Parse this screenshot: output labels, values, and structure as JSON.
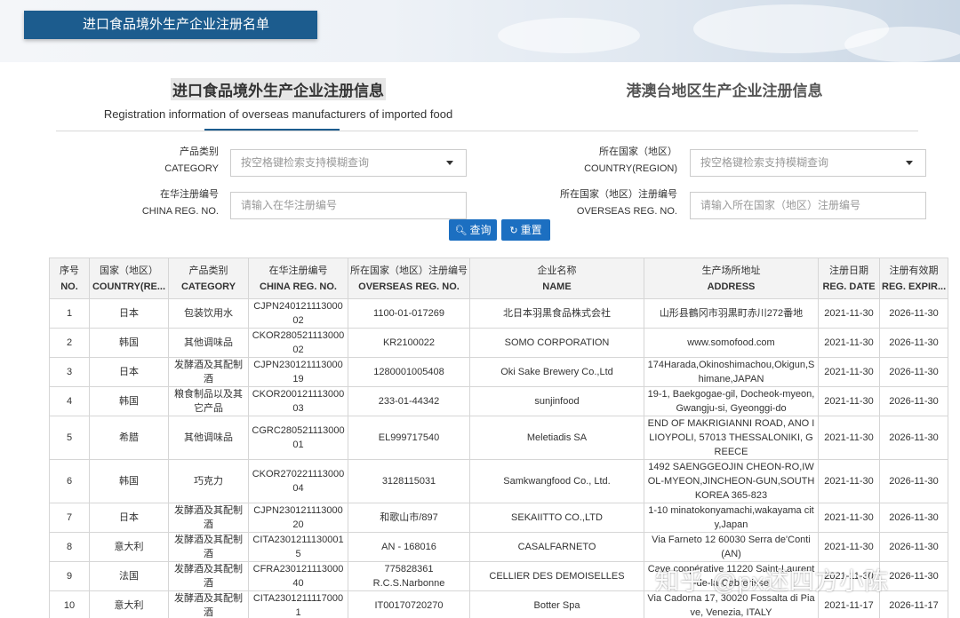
{
  "header": {
    "title": "进口食品境外生产企业注册名单"
  },
  "tabs": [
    {
      "title": "进口食品境外生产企业注册信息",
      "subtitle": "Registration information of overseas manufacturers of imported food"
    },
    {
      "title": "港澳台地区生产企业注册信息",
      "subtitle": ""
    }
  ],
  "form": {
    "category": {
      "label_cn": "产品类别",
      "label_en": "CATEGORY",
      "placeholder": "按空格键检索支持模糊查询"
    },
    "country": {
      "label_cn": "所在国家（地区）",
      "label_en": "COUNTRY(REGION)",
      "placeholder": "按空格键检索支持模糊查询"
    },
    "china_reg": {
      "label_cn": "在华注册编号",
      "label_en": "CHINA REG. NO.",
      "placeholder": "请输入在华注册编号"
    },
    "overseas_reg": {
      "label_cn": "所在国家（地区）注册编号",
      "label_en": "OVERSEAS REG. NO.",
      "placeholder": "请输入所在国家（地区）注册编号"
    },
    "search_label": "查询",
    "reset_label": "重置"
  },
  "table": {
    "columns": [
      {
        "cn": "序号",
        "en": "NO."
      },
      {
        "cn": "国家（地区）",
        "en": "COUNTRY(RE..."
      },
      {
        "cn": "产品类别",
        "en": "CATEGORY"
      },
      {
        "cn": "在华注册编号",
        "en": "CHINA REG. NO."
      },
      {
        "cn": "所在国家（地区）注册编号",
        "en": "OVERSEAS REG. NO."
      },
      {
        "cn": "企业名称",
        "en": "NAME"
      },
      {
        "cn": "生产场所地址",
        "en": "ADDRESS"
      },
      {
        "cn": "注册日期",
        "en": "REG. DATE"
      },
      {
        "cn": "注册有效期",
        "en": "REG. EXPIR..."
      }
    ],
    "rows": [
      [
        "1",
        "日本",
        "包装饮用水",
        "CJPN24012111300002",
        "1100-01-017269",
        "北日本羽黒食品株式会社",
        "山形县鶴冈市羽黒町赤川272番地",
        "2021-11-30",
        "2026-11-30"
      ],
      [
        "2",
        "韩国",
        "其他调味品",
        "CKOR28052111300002",
        "KR2100022",
        "SOMO CORPORATION",
        "www.somofood.com",
        "2021-11-30",
        "2026-11-30"
      ],
      [
        "3",
        "日本",
        "发酵酒及其配制酒",
        "CJPN23012111300019",
        "1280001005408",
        "Oki Sake Brewery Co.,Ltd",
        "174Harada,Okinoshimachou,Okigun,Shimane,JAPAN",
        "2021-11-30",
        "2026-11-30"
      ],
      [
        "4",
        "韩国",
        "粮食制品以及其它产品",
        "CKOR20012111300003",
        "233-01-44342",
        "sunjinfood",
        "19-1, Baekgogae-gil, Docheok-myeon, Gwangju-si, Gyeonggi-do",
        "2021-11-30",
        "2026-11-30"
      ],
      [
        "5",
        "希腊",
        "其他调味品",
        "CGRC28052111300001",
        "EL999717540",
        "Meletiadis SA",
        "END OF MAKRIGIANNI ROAD, ANO ILIOYPOLI, 57013 THESSALONIKI, GREECE",
        "2021-11-30",
        "2026-11-30"
      ],
      [
        "6",
        "韩国",
        "巧克力",
        "CKOR27022111300004",
        "3128115031",
        "Samkwangfood Co., Ltd.",
        "1492 SAENGGEOJIN CHEON-RO,IWOL-MYEON,JINCHEON-GUN,SOUTH KOREA 365-823",
        "2021-11-30",
        "2026-11-30"
      ],
      [
        "7",
        "日本",
        "发酵酒及其配制酒",
        "CJPN23012111300020",
        "和歌山市/897",
        "SEKAIITTO CO.,LTD",
        "1-10 minatokonyamachi,wakayama city,Japan",
        "2021-11-30",
        "2026-11-30"
      ],
      [
        "8",
        "意大利",
        "发酵酒及其配制酒",
        "CITA23012111300015",
        "AN - 168016",
        "CASALFARNETO",
        "Via Farneto 12 60030 Serra de'Conti (AN)",
        "2021-11-30",
        "2026-11-30"
      ],
      [
        "9",
        "法国",
        "发酵酒及其配制酒",
        "CFRA23012111300040",
        "775828361 R.C.S.Narbonne",
        "CELLIER DES DEMOISELLES",
        "Cave coopérative 11220 Saint-Laurent-de-la-Cabrerisse",
        "2021-11-30",
        "2026-11-30"
      ],
      [
        "10",
        "意大利",
        "发酵酒及其配制酒",
        "CITA23012111170001",
        "IT00170720270",
        "Botter Spa",
        "Via Cadorna 17, 30020 Fossalta di Piave, Venezia, ITALY",
        "2021-11-17",
        "2026-11-17"
      ]
    ]
  },
  "watermark": "知乎 @px述四方小陈",
  "colors": {
    "brand": "#1c5c8e",
    "button": "#1c6fc1"
  }
}
